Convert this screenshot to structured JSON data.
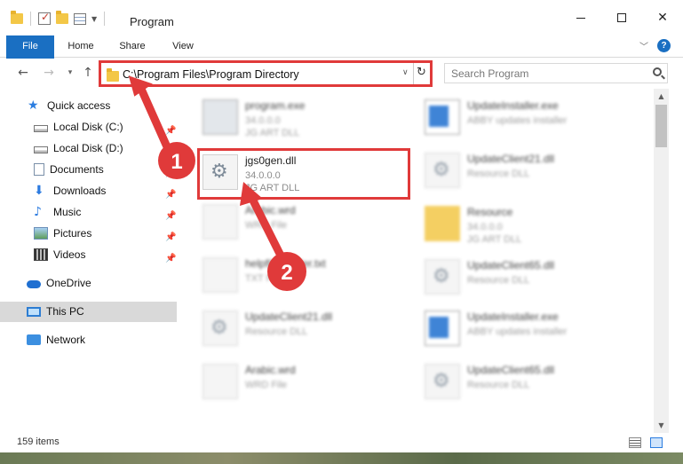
{
  "window": {
    "title": "Program",
    "controls": {
      "minimize": "minimize",
      "maximize": "maximize",
      "close": "✕"
    }
  },
  "ribbon": {
    "tabs": [
      "File",
      "Home",
      "Share",
      "View"
    ],
    "help": "?"
  },
  "navigation": {
    "address": "C:\\Program Files\\Program Directory",
    "search_placeholder": "Search Program"
  },
  "sidebar": {
    "items": [
      {
        "label": "Quick access",
        "icon": "star-icon",
        "pinned": false
      },
      {
        "label": "Local Disk (C:)",
        "icon": "disk-icon",
        "pinned": true
      },
      {
        "label": "Local Disk (D:)",
        "icon": "disk-icon",
        "pinned": false
      },
      {
        "label": "Documents",
        "icon": "documents-icon",
        "pinned": true
      },
      {
        "label": "Downloads",
        "icon": "downloads-icon",
        "pinned": true
      },
      {
        "label": "Music",
        "icon": "music-icon",
        "pinned": true
      },
      {
        "label": "Pictures",
        "icon": "pictures-icon",
        "pinned": true
      },
      {
        "label": "Videos",
        "icon": "videos-icon",
        "pinned": true
      },
      {
        "label": "OneDrive",
        "icon": "onedrive-icon",
        "pinned": false
      },
      {
        "label": "This PC",
        "icon": "this-pc-icon",
        "pinned": false,
        "selected": true
      },
      {
        "label": "Network",
        "icon": "network-icon",
        "pinned": false
      }
    ]
  },
  "files": {
    "left": [
      {
        "name": "program.exe",
        "line2": "34.0.0.0",
        "line3": "JG ART DLL",
        "icon": "exe-icon"
      },
      {
        "name": "jgs0gen.dll",
        "line2": "34.0.0.0",
        "line3": "JG ART DLL",
        "icon": "dll-gear-icon",
        "highlighted": true
      },
      {
        "name": "Arabic.wrd",
        "line2": "WRD File",
        "line3": "",
        "icon": "blank-file-icon"
      },
      {
        "name": "helpfileheader.txt",
        "line2": "TXT File",
        "line3": "",
        "icon": "blank-file-icon"
      },
      {
        "name": "UpdateClient21.dll",
        "line2": "Resource DLL",
        "line3": "",
        "icon": "dll-gear-icon"
      },
      {
        "name": "Arabic.wrd",
        "line2": "WRD File",
        "line3": "",
        "icon": "blank-file-icon"
      }
    ],
    "right": [
      {
        "name": "UpdateInstaller.exe",
        "line2": "ABBY updates installer",
        "line3": "",
        "icon": "installer-icon"
      },
      {
        "name": "UpdateClient21.dll",
        "line2": "Resource DLL",
        "line3": "",
        "icon": "dll-gear-icon"
      },
      {
        "name": "Resource",
        "line2": "34.0.0.0",
        "line3": "JG ART DLL",
        "icon": "folder-icon"
      },
      {
        "name": "UpdateClient65.dll",
        "line2": "Resource DLL",
        "line3": "",
        "icon": "dll-gear-icon"
      },
      {
        "name": "UpdateInstaller.exe",
        "line2": "ABBY updates installer",
        "line3": "",
        "icon": "installer-icon"
      },
      {
        "name": "UpdateClient65.dll",
        "line2": "Resource DLL",
        "line3": "",
        "icon": "dll-gear-icon"
      }
    ]
  },
  "status": {
    "items_count": "159 items"
  },
  "annotations": {
    "step1": "1",
    "step2": "2",
    "color": "#e03a3a"
  }
}
